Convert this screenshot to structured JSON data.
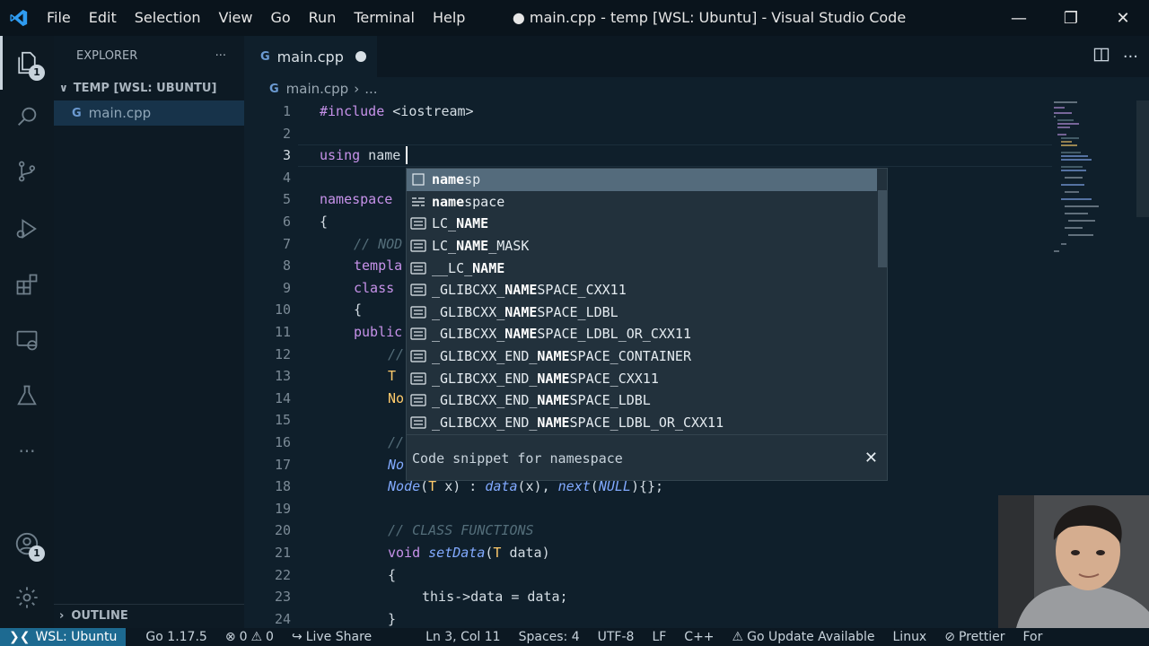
{
  "window": {
    "title": "● main.cpp - temp [WSL: Ubuntu] - Visual Studio Code",
    "menu": [
      "File",
      "Edit",
      "Selection",
      "View",
      "Go",
      "Run",
      "Terminal",
      "Help"
    ]
  },
  "activity_bar": {
    "explorer_badge": "1",
    "accounts_badge": "1",
    "icons": [
      "explorer-icon",
      "search-icon",
      "source-control-icon",
      "run-debug-icon",
      "extensions-icon",
      "remote-explorer-icon",
      "testing-icon",
      "more-icon",
      "accounts-icon",
      "settings-gear-icon"
    ]
  },
  "sidebar": {
    "title": "EXPLORER",
    "more": "···",
    "section": "TEMP [WSL: UBUNTU]",
    "files": [
      {
        "name": "main.cpp"
      }
    ],
    "outline": "OUTLINE"
  },
  "tab": {
    "name": "main.cpp"
  },
  "breadcrumb": {
    "file": "main.cpp",
    "sep": "›",
    "rest": "..."
  },
  "editor": {
    "lines": [
      {
        "n": "1"
      },
      {
        "n": "2"
      },
      {
        "n": "3"
      },
      {
        "n": "4"
      },
      {
        "n": "5"
      },
      {
        "n": "6"
      },
      {
        "n": "7"
      },
      {
        "n": "8"
      },
      {
        "n": "9"
      },
      {
        "n": "10"
      },
      {
        "n": "11"
      },
      {
        "n": "12"
      },
      {
        "n": "13"
      },
      {
        "n": "14"
      },
      {
        "n": "15"
      },
      {
        "n": "16"
      },
      {
        "n": "17"
      },
      {
        "n": "18"
      },
      {
        "n": "19"
      },
      {
        "n": "20"
      },
      {
        "n": "21"
      },
      {
        "n": "22"
      },
      {
        "n": "23"
      },
      {
        "n": "24"
      }
    ],
    "tokens": {
      "l1_pp": "#include",
      "l1_rest": " <iostream>",
      "l3_kw": "using",
      "l3_rest": " name",
      "l5_kw": "namespace",
      "l6": "{",
      "l7": "// NOD",
      "l8": "templa",
      "l9": "class",
      "l10": "{",
      "l11": "public",
      "l12": "//",
      "l13": "T",
      "l14": "No",
      "l16": "//",
      "l17": "No",
      "l18_fn": "Node",
      "l18_a": "(",
      "l18_ty": "T",
      "l18_b": " x) : ",
      "l18_fn2": "data",
      "l18_c": "(x), ",
      "l18_fn3": "next",
      "l18_d": "(",
      "l18_it": "NULL",
      "l18_e": "){};",
      "l20": "// CLASS FUNCTIONS",
      "l21_kw": "void",
      "l21_fn": " setData",
      "l21_a": "(",
      "l21_ty": "T",
      "l21_b": " data)",
      "l22": "{",
      "l23": "this->data = data;",
      "l24": "}"
    }
  },
  "suggest": {
    "items": [
      {
        "pre": "",
        "match": "name",
        "post": "sp",
        "icon": "snippet-icon"
      },
      {
        "pre": "",
        "match": "name",
        "post": "space",
        "icon": "keyword-icon"
      },
      {
        "pre": "LC_",
        "match": "NAME",
        "post": "",
        "icon": "text-icon"
      },
      {
        "pre": "LC_",
        "match": "NAME",
        "post": "_MASK",
        "icon": "text-icon"
      },
      {
        "pre": "__LC_",
        "match": "NAME",
        "post": "",
        "icon": "text-icon"
      },
      {
        "pre": "_GLIBCXX_",
        "match": "NAME",
        "post": "SPACE_CXX11",
        "icon": "text-icon"
      },
      {
        "pre": "_GLIBCXX_",
        "match": "NAME",
        "post": "SPACE_LDBL",
        "icon": "text-icon"
      },
      {
        "pre": "_GLIBCXX_",
        "match": "NAME",
        "post": "SPACE_LDBL_OR_CXX11",
        "icon": "text-icon"
      },
      {
        "pre": "_GLIBCXX_END_",
        "match": "NAME",
        "post": "SPACE_CONTAINER",
        "icon": "text-icon"
      },
      {
        "pre": "_GLIBCXX_END_",
        "match": "NAME",
        "post": "SPACE_CXX11",
        "icon": "text-icon"
      },
      {
        "pre": "_GLIBCXX_END_",
        "match": "NAME",
        "post": "SPACE_LDBL",
        "icon": "text-icon"
      },
      {
        "pre": "_GLIBCXX_END_",
        "match": "NAME",
        "post": "SPACE_LDBL_OR_CXX11",
        "icon": "text-icon"
      }
    ],
    "detail": "Code snippet for namespace",
    "close": "✕"
  },
  "statusbar": {
    "remote": "WSL: Ubuntu",
    "go_version": "Go 1.17.5",
    "errors": "0",
    "warnings": "0",
    "live_share": "Live Share",
    "position": "Ln 3, Col 11",
    "spaces": "Spaces: 4",
    "encoding": "UTF-8",
    "eol": "LF",
    "language": "C++",
    "go_update": "Go Update Available",
    "os": "Linux",
    "prettier": "Prettier",
    "more": "For"
  }
}
